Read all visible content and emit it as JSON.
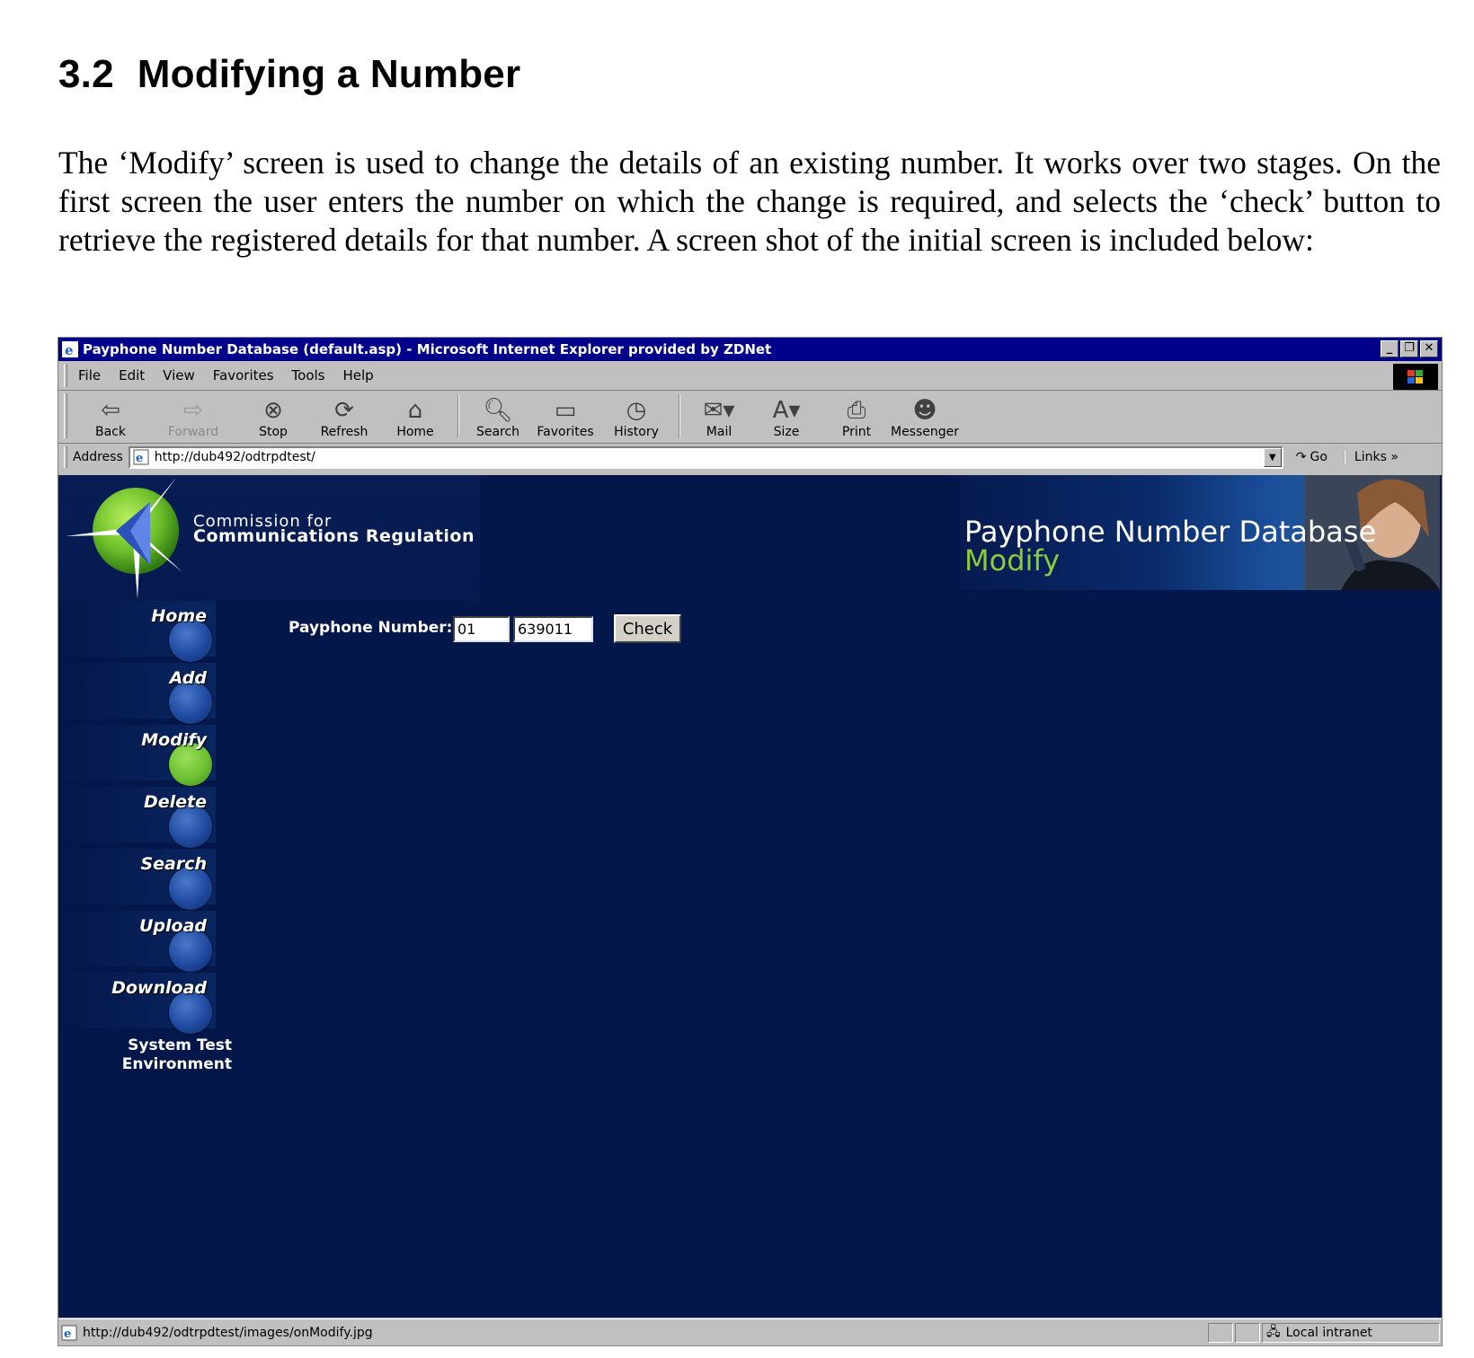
{
  "document": {
    "section_number": "3.2",
    "section_title": "Modifying a Number",
    "paragraph": "The ‘Modify’ screen is used to change the details of an existing number. It works over two stages. On the first screen the user enters the number on which the change is required, and selects the ‘check’ button to retrieve the registered details for that number. A screen shot of the initial screen is included below:"
  },
  "browser": {
    "window_title": "Payphone Number Database (default.asp) - Microsoft Internet Explorer provided by ZDNet",
    "menu": [
      "File",
      "Edit",
      "View",
      "Favorites",
      "Tools",
      "Help"
    ],
    "toolbar": {
      "back": "Back",
      "forward": "Forward",
      "stop": "Stop",
      "refresh": "Refresh",
      "home": "Home",
      "search": "Search",
      "favorites": "Favorites",
      "history": "History",
      "mail": "Mail",
      "size": "Size",
      "print": "Print",
      "messenger": "Messenger"
    },
    "address_label": "Address",
    "address_url": "http://dub492/odtrpdtest/",
    "go_label": "Go",
    "links_label": "Links",
    "status_text": "http://dub492/odtrpdtest/images/onModify.jpg",
    "zone_text": "Local intranet"
  },
  "page": {
    "org_line1": "Commission for",
    "org_line2": "Communications Regulation",
    "banner_title": "Payphone Number Database",
    "banner_subtitle": "Modify",
    "nav": [
      "Home",
      "Add",
      "Modify",
      "Delete",
      "Search",
      "Upload",
      "Download"
    ],
    "active_nav": "Modify",
    "environment_line1": "System Test",
    "environment_line2": "Environment",
    "form_label": "Payphone Number:",
    "area_code_value": "01",
    "number_value": "639011",
    "check_label": "Check"
  },
  "colors": {
    "page_background": "#04174a",
    "title_bar": "#00008a",
    "active_nav": "#6bc033",
    "subtitle": "#8ccc3a"
  },
  "icons": {
    "back": "back-arrow-icon",
    "forward": "forward-arrow-icon",
    "stop": "stop-icon",
    "refresh": "refresh-icon",
    "home": "home-icon",
    "search": "search-icon",
    "favorites": "favorites-folder-icon",
    "history": "history-icon",
    "mail": "mail-icon",
    "size": "text-size-icon",
    "print": "printer-icon",
    "messenger": "messenger-icon"
  }
}
